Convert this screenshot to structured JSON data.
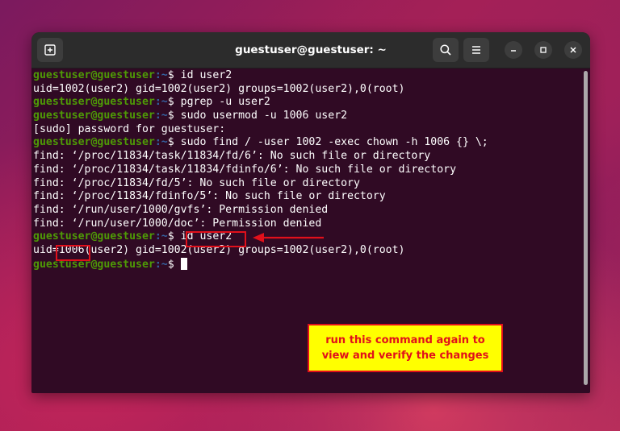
{
  "window": {
    "title": "guestuser@guestuser: ~"
  },
  "prompt": {
    "user": "guestuser@guestuser",
    "path": ":~",
    "symbol": "$ "
  },
  "lines": [
    {
      "type": "prompt",
      "cmd": "id user2"
    },
    {
      "type": "out",
      "text": "uid=1002(user2) gid=1002(user2) groups=1002(user2),0(root)"
    },
    {
      "type": "prompt",
      "cmd": "pgrep -u user2"
    },
    {
      "type": "prompt",
      "cmd": "sudo usermod -u 1006 user2"
    },
    {
      "type": "out",
      "text": "[sudo] password for guestuser:"
    },
    {
      "type": "prompt",
      "cmd": "sudo find / -user 1002 -exec chown -h 1006 {} \\;"
    },
    {
      "type": "out",
      "text": "find: ‘/proc/11834/task/11834/fd/6’: No such file or directory"
    },
    {
      "type": "out",
      "text": "find: ‘/proc/11834/task/11834/fdinfo/6’: No such file or directory"
    },
    {
      "type": "out",
      "text": "find: ‘/proc/11834/fd/5’: No such file or directory"
    },
    {
      "type": "out",
      "text": "find: ‘/proc/11834/fdinfo/5’: No such file or directory"
    },
    {
      "type": "out",
      "text": "find: ‘/run/user/1000/gvfs’: Permission denied"
    },
    {
      "type": "out",
      "text": "find: ‘/run/user/1000/doc’: Permission denied"
    },
    {
      "type": "prompt",
      "cmd": "id user2"
    },
    {
      "type": "out",
      "text": "uid=1006(user2) gid=1002(user2) groups=1002(user2),0(root)"
    },
    {
      "type": "prompt",
      "cmd": "",
      "cursor": true
    }
  ],
  "annotation": {
    "callout_line1": "run this command again to",
    "callout_line2": "view and verify the changes",
    "color": "#e1101b",
    "background": "#ffff00"
  },
  "icons": {
    "new_tab": "new-tab-icon",
    "search": "search-icon",
    "menu": "hamburger-menu-icon",
    "minimize": "minimize-icon",
    "maximize": "maximize-icon",
    "close": "close-icon"
  },
  "colors": {
    "terminal_bg": "#300a24",
    "prompt_user": "#4e9a06",
    "prompt_path": "#3465a4",
    "titlebar": "#2c2c2c"
  }
}
